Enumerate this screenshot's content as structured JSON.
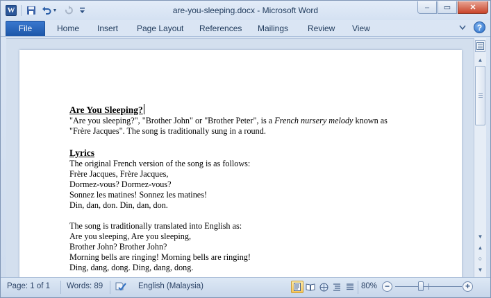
{
  "window": {
    "title": "are-you-sleeping.docx - Microsoft Word",
    "app_icon_letter": "W",
    "controls": {
      "minimize": "–",
      "restore": "▭",
      "close": "✕"
    }
  },
  "qat": {
    "save_icon": "save-icon",
    "undo_icon": "undo-icon",
    "redo_icon": "redo-icon",
    "customize_icon": "customize-qat-icon"
  },
  "ribbon": {
    "file_tab": "File",
    "tabs": [
      "Home",
      "Insert",
      "Page Layout",
      "References",
      "Mailings",
      "Review",
      "View"
    ],
    "help_label": "?"
  },
  "document": {
    "heading1": "Are You Sleeping?",
    "intro_part1": "\"Are you sleeping?\", \"Brother John\" or \"Brother Peter\", is a ",
    "intro_italic": "French nursery melody",
    "intro_part2": " known as",
    "intro_line2": "\"Frère Jacques\". The song is traditionally sung in a round.",
    "heading2": "Lyrics",
    "french_intro": "The original French version of the song is as follows:",
    "french_lines": [
      "Frère Jacques, Frère Jacques,",
      "Dormez-vous? Dormez-vous?",
      "Sonnez les matines! Sonnez les matines!",
      "Din, dan, don. Din, dan, don."
    ],
    "english_intro": "The song is traditionally translated into English as:",
    "english_lines": [
      "Are you sleeping, Are you sleeping,",
      "Brother John? Brother John?",
      "Morning bells are ringing! Morning bells are ringing!",
      "Ding, dang, dong. Ding, dang, dong."
    ]
  },
  "status": {
    "page": "Page: 1 of 1",
    "words": "Words: 89",
    "language": "English (Malaysia)",
    "zoom": "80%",
    "zoom_value": 0.8
  },
  "colors": {
    "file_tab": "#2b5fb0",
    "close_button": "#c9442a",
    "active_view": "#f7c65b"
  }
}
